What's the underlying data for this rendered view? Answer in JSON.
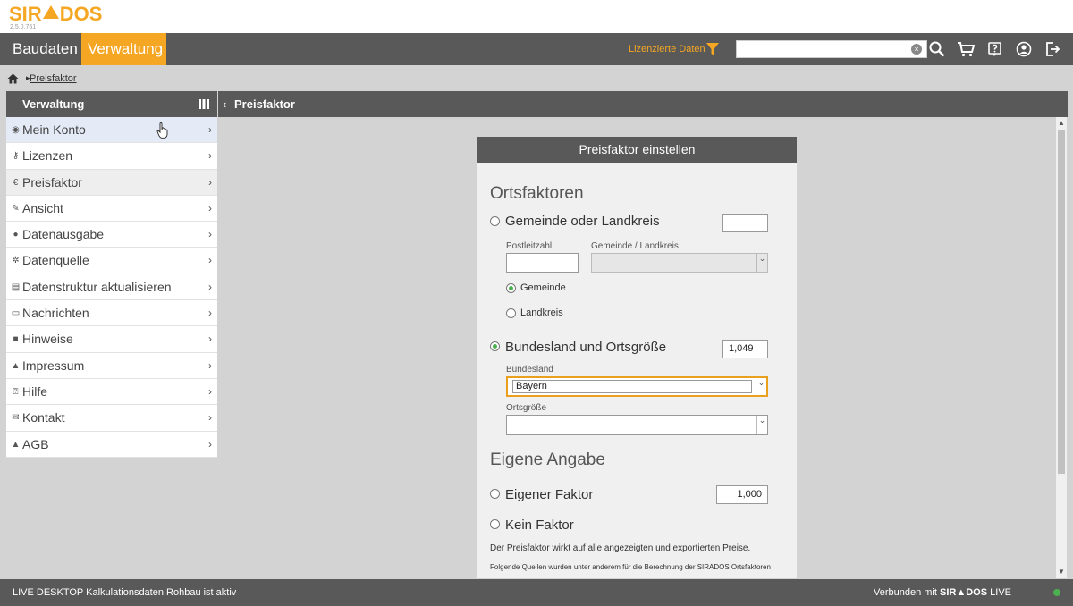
{
  "app": {
    "logo_text_a": "SIR",
    "logo_text_b": "DOS",
    "version": "2.5.0.761"
  },
  "nav": {
    "tabs": [
      "Baudaten",
      "Verwaltung"
    ],
    "active_tab": "Verwaltung",
    "licensed_data": "Lizenzierte Daten",
    "search": {
      "value": "",
      "placeholder": ""
    }
  },
  "breadcrumb": {
    "current": "Preisfaktor"
  },
  "sidebar": {
    "title": "Verwaltung",
    "items": [
      {
        "label": "Mein Konto",
        "icon": "user-icon"
      },
      {
        "label": "Lizenzen",
        "icon": "key-icon"
      },
      {
        "label": "Preisfaktor",
        "icon": "euro-icon"
      },
      {
        "label": "Ansicht",
        "icon": "wrench-icon"
      },
      {
        "label": "Datenausgabe",
        "icon": "download-icon"
      },
      {
        "label": "Datenquelle",
        "icon": "gear-icon"
      },
      {
        "label": "Datenstruktur aktualisieren",
        "icon": "refresh-icon"
      },
      {
        "label": "Nachrichten",
        "icon": "news-icon"
      },
      {
        "label": "Hinweise",
        "icon": "folder-icon"
      },
      {
        "label": "Impressum",
        "icon": "logo-icon"
      },
      {
        "label": "Hilfe",
        "icon": "help-icon"
      },
      {
        "label": "Kontakt",
        "icon": "mail-icon"
      },
      {
        "label": "AGB",
        "icon": "logo-icon"
      }
    ],
    "active_item": "Preisfaktor",
    "hover_item": "Mein Konto"
  },
  "content": {
    "header": "Preisfaktor",
    "panel": {
      "title": "Preisfaktor einstellen",
      "ortsfaktoren_heading": "Ortsfaktoren",
      "gemeinde_option": {
        "label": "Gemeinde oder Landkreis",
        "value": "",
        "selected": false
      },
      "postleitzahl_label": "Postleitzahl",
      "postleitzahl_value": "",
      "gemeinde_landkreis_label": "Gemeinde / Landkreis",
      "gemeinde_landkreis_value": "",
      "sub_options": [
        {
          "label": "Gemeinde",
          "selected": true
        },
        {
          "label": "Landkreis",
          "selected": false
        }
      ],
      "bundesland_option": {
        "label": "Bundesland und Ortsgröße",
        "value": "1,049",
        "selected": true
      },
      "bundesland_label": "Bundesland",
      "bundesland_value": "Bayern",
      "ortsgroesse_label": "Ortsgröße",
      "ortsgroesse_value": "",
      "eigene_heading": "Eigene Angabe",
      "eigener_faktor": {
        "label": "Eigener Faktor",
        "value": "1,000",
        "selected": false
      },
      "kein_faktor": {
        "label": "Kein Faktor",
        "selected": false
      },
      "note_1": "Der Preisfaktor wirkt auf alle angezeigten und exportierten Preise.",
      "note_2": "Folgende Quellen wurden unter anderem für die Berechnung der SIRADOS Ortsfaktoren"
    }
  },
  "status": {
    "left": "LIVE DESKTOP Kalkulationsdaten Rohbau ist aktiv",
    "connected_prefix": "Verbunden mit",
    "brand_a": "SIR",
    "brand_b": "DOS",
    "connected_suffix": "LIVE"
  },
  "colors": {
    "accent": "#f5a623",
    "dark": "#595959",
    "online": "#4caf50"
  }
}
